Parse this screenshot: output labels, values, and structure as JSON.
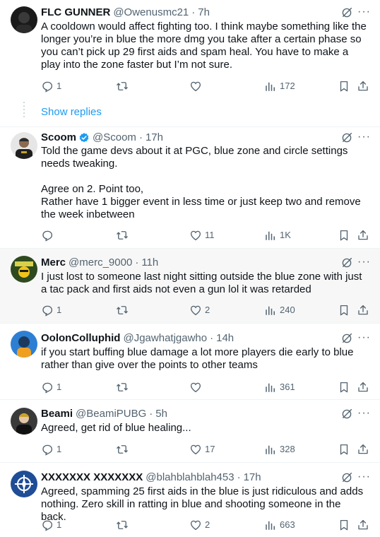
{
  "tweets": [
    {
      "name": "FLC GUNNER",
      "handle": "@Owenusmc21",
      "dot": "·",
      "time": "7h",
      "text": "A cooldown would affect fighting too. I think maybe something like the longer you’re in blue the more dmg you take after a certain phase so you can’t pick up 29 first aids and spam heal. You have to make a play into the zone faster but I’m not sure.",
      "replies": "1",
      "reposts": "",
      "likes": "",
      "views": "172",
      "show_replies": "Show replies"
    },
    {
      "name": "Scoom",
      "handle": "@Scoom",
      "dot": "·",
      "time": "17h",
      "verified": true,
      "text": "Told the game devs about it at PGC, blue zone and circle settings needs tweaking.\n\nAgree on 2. Point too,\nRather have 1 bigger event in less time or just keep two and remove the week inbetween",
      "replies": "",
      "reposts": "",
      "likes": "11",
      "views": "1K"
    },
    {
      "name": "Merc",
      "handle": "@merc_9000",
      "dot": "·",
      "time": "11h",
      "text": "I just lost to someone last night sitting outside the blue zone with just a tac pack and first aids not even a gun lol it was retarded",
      "replies": "1",
      "reposts": "",
      "likes": "2",
      "views": "240"
    },
    {
      "name": "OolonColluphid",
      "handle": "@Jgawhatjgawho",
      "dot": "·",
      "time": "14h",
      "text": "if you start buffing blue damage a lot more players die early to blue rather than give over the points to other teams",
      "replies": "1",
      "reposts": "",
      "likes": "",
      "views": "361"
    },
    {
      "name": "Beami",
      "handle": "@BeamiPUBG",
      "dot": "·",
      "time": "5h",
      "text": "Agreed, get rid of blue healing...",
      "replies": "1",
      "reposts": "",
      "likes": "17",
      "views": "328"
    },
    {
      "name": "XXXXXXX XXXXXXX",
      "handle": "@blahblahblah453",
      "dot": "·",
      "time": "17h",
      "text": "Agreed, spamming 25 first aids in the blue is just ridiculous and adds nothing. Zero skill in ratting in blue and shooting someone in the back.",
      "replies": "1",
      "reposts": "",
      "likes": "2",
      "views": "663"
    }
  ],
  "colors": {
    "accent": "#1d9bf0",
    "muted": "#536471",
    "text": "#0f1419",
    "border": "#eff3f4"
  },
  "icons": [
    "reply-icon",
    "repost-icon",
    "like-icon",
    "views-icon",
    "bookmark-icon",
    "share-icon",
    "grok-icon",
    "more-icon",
    "verified-icon"
  ]
}
